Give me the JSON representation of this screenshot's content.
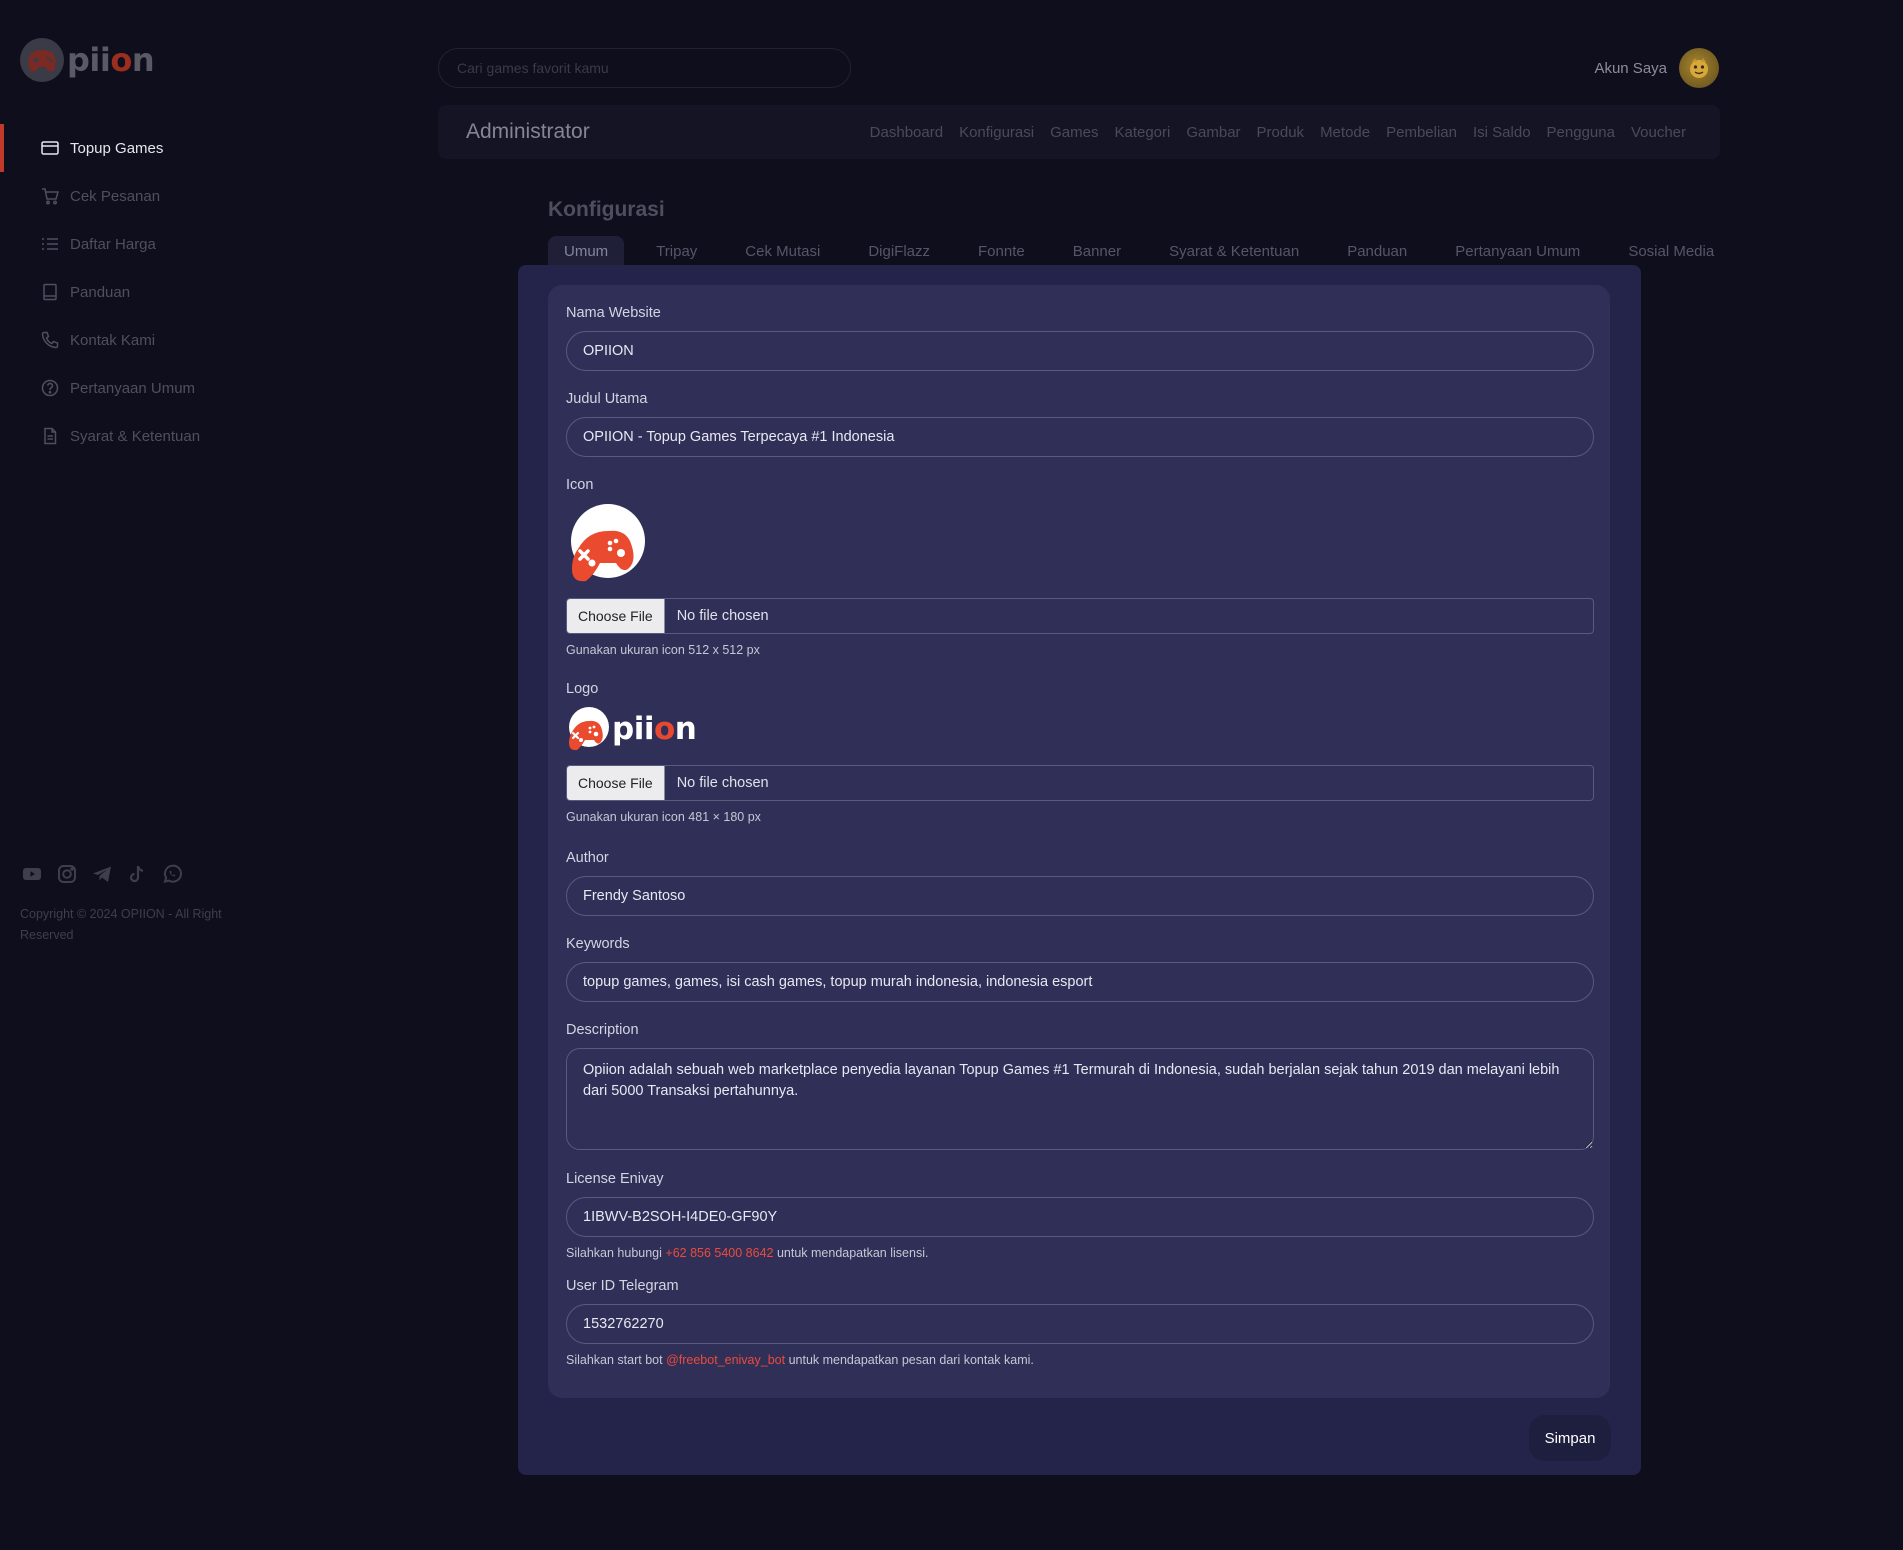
{
  "brand": {
    "logo_text_a": "pii",
    "logo_text_b": "o",
    "logo_text_c": "n"
  },
  "sidebar": {
    "items": [
      {
        "label": "Topup Games",
        "icon": "card-icon",
        "active": true
      },
      {
        "label": "Cek Pesanan",
        "icon": "cart-icon"
      },
      {
        "label": "Daftar Harga",
        "icon": "list-icon"
      },
      {
        "label": "Panduan",
        "icon": "book-icon"
      },
      {
        "label": "Kontak Kami",
        "icon": "phone-icon"
      },
      {
        "label": "Pertanyaan Umum",
        "icon": "question-icon"
      },
      {
        "label": "Syarat & Ketentuan",
        "icon": "document-icon"
      }
    ],
    "social": [
      "youtube-icon",
      "instagram-icon",
      "telegram-icon",
      "tiktok-icon",
      "whatsapp-icon"
    ],
    "copyright": "Copyright © 2024 OPIION - All Right Reserved"
  },
  "header": {
    "search_placeholder": "Cari games favorit kamu",
    "account_label": "Akun Saya"
  },
  "admin": {
    "title": "Administrator",
    "links": [
      "Dashboard",
      "Konfigurasi",
      "Games",
      "Kategori",
      "Gambar",
      "Produk",
      "Metode",
      "Pembelian",
      "Isi Saldo",
      "Pengguna",
      "Voucher"
    ]
  },
  "config": {
    "title": "Konfigurasi",
    "tabs": [
      "Umum",
      "Tripay",
      "Cek Mutasi",
      "DigiFlazz",
      "Fonnte",
      "Banner",
      "Syarat & Ketentuan",
      "Panduan",
      "Pertanyaan Umum",
      "Sosial Media"
    ],
    "active_tab": "Umum"
  },
  "form": {
    "nama_website": {
      "label": "Nama Website",
      "value": "OPIION"
    },
    "judul_utama": {
      "label": "Judul Utama",
      "value": "OPIION - Topup Games Terpecaya #1 Indonesia"
    },
    "icon": {
      "label": "Icon",
      "button": "Choose File",
      "file": "No file chosen",
      "hint": "Gunakan ukuran icon 512 x 512 px"
    },
    "logo": {
      "label": "Logo",
      "button": "Choose File",
      "file": "No file chosen",
      "hint": "Gunakan ukuran icon 481 × 180 px",
      "preview_a": "pii",
      "preview_b": "o",
      "preview_c": "n"
    },
    "author": {
      "label": "Author",
      "value": "Frendy Santoso"
    },
    "keywords": {
      "label": "Keywords",
      "value": "topup games, games, isi cash games, topup murah indonesia, indonesia esport"
    },
    "description": {
      "label": "Description",
      "value": "Opiion adalah sebuah web marketplace penyedia layanan Topup Games #1 Termurah di Indonesia, sudah berjalan sejak tahun 2019 dan melayani lebih dari 5000 Transaksi pertahunnya."
    },
    "license": {
      "label": "License Enivay",
      "value": "1IBWV-B2SOH-I4DE0-GF90Y",
      "hint_pre": "Silahkan hubungi ",
      "hint_link": "+62 856 5400 8642",
      "hint_post": " untuk mendapatkan lisensi."
    },
    "telegram": {
      "label": "User ID Telegram",
      "value": "1532762270",
      "hint_pre": "Silahkan start bot ",
      "hint_link": "@freebot_enivay_bot",
      "hint_post": " untuk mendapatkan pesan dari kontak kami."
    },
    "save_label": "Simpan"
  },
  "colors": {
    "accent": "#e8482f",
    "panel": "#24244a",
    "card": "#2f2f57",
    "background": "#0e0e1c"
  }
}
